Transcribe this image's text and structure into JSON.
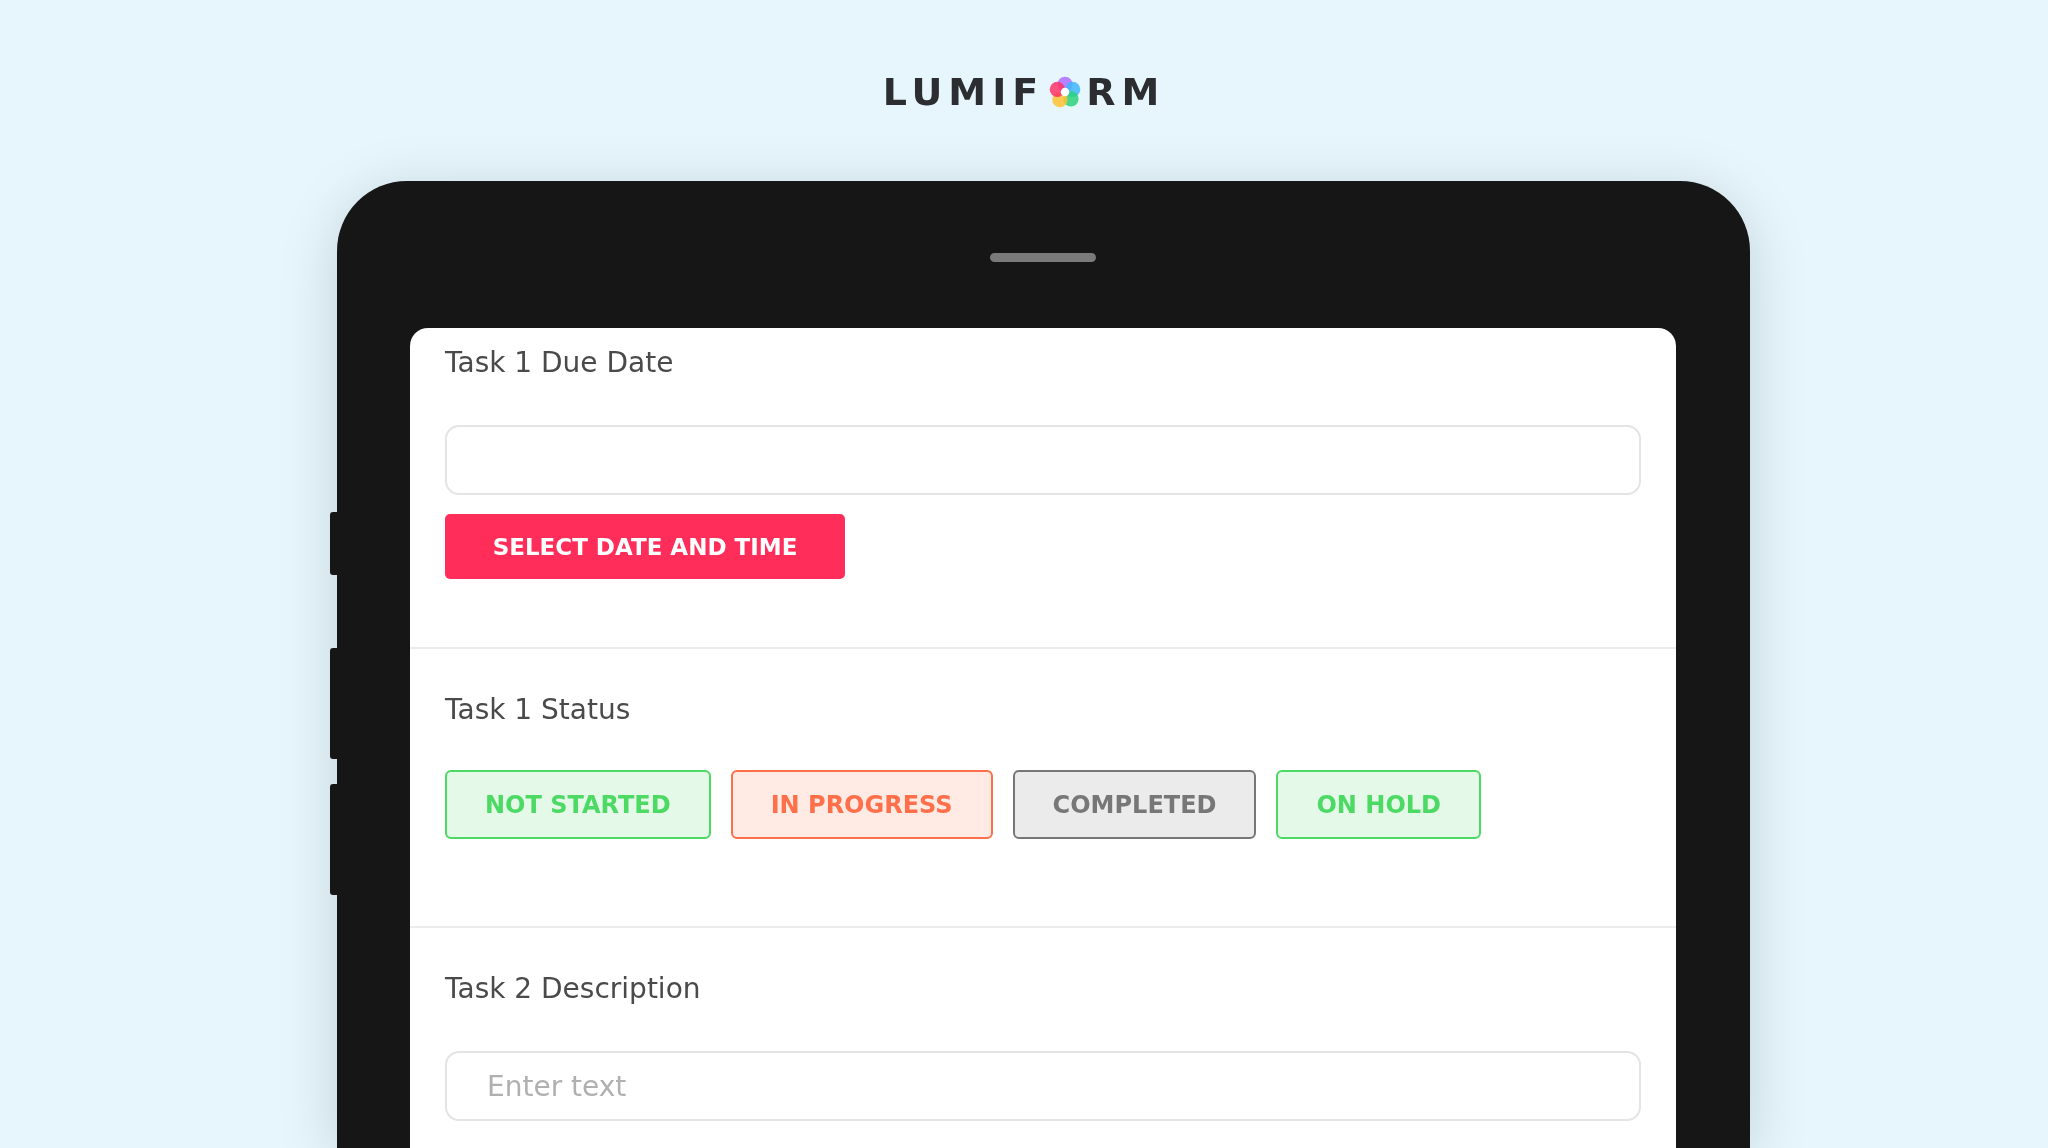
{
  "logo": {
    "before": "LUMIF",
    "after": "RM"
  },
  "sections": [
    {
      "kind": "date",
      "label": "Task 1 Due Date",
      "button": "SELECT DATE AND TIME"
    },
    {
      "kind": "status",
      "label": "Task 1 Status",
      "options": [
        {
          "label": "NOT STARTED",
          "color": "#4cd964"
        },
        {
          "label": "IN PROGRESS",
          "color": "#ff6f4a"
        },
        {
          "label": "COMPLETED",
          "color": "#777777"
        },
        {
          "label": "ON HOLD",
          "color": "#4cd964"
        }
      ]
    },
    {
      "kind": "text",
      "label": "Task 2 Description",
      "placeholder": "Enter text"
    }
  ]
}
